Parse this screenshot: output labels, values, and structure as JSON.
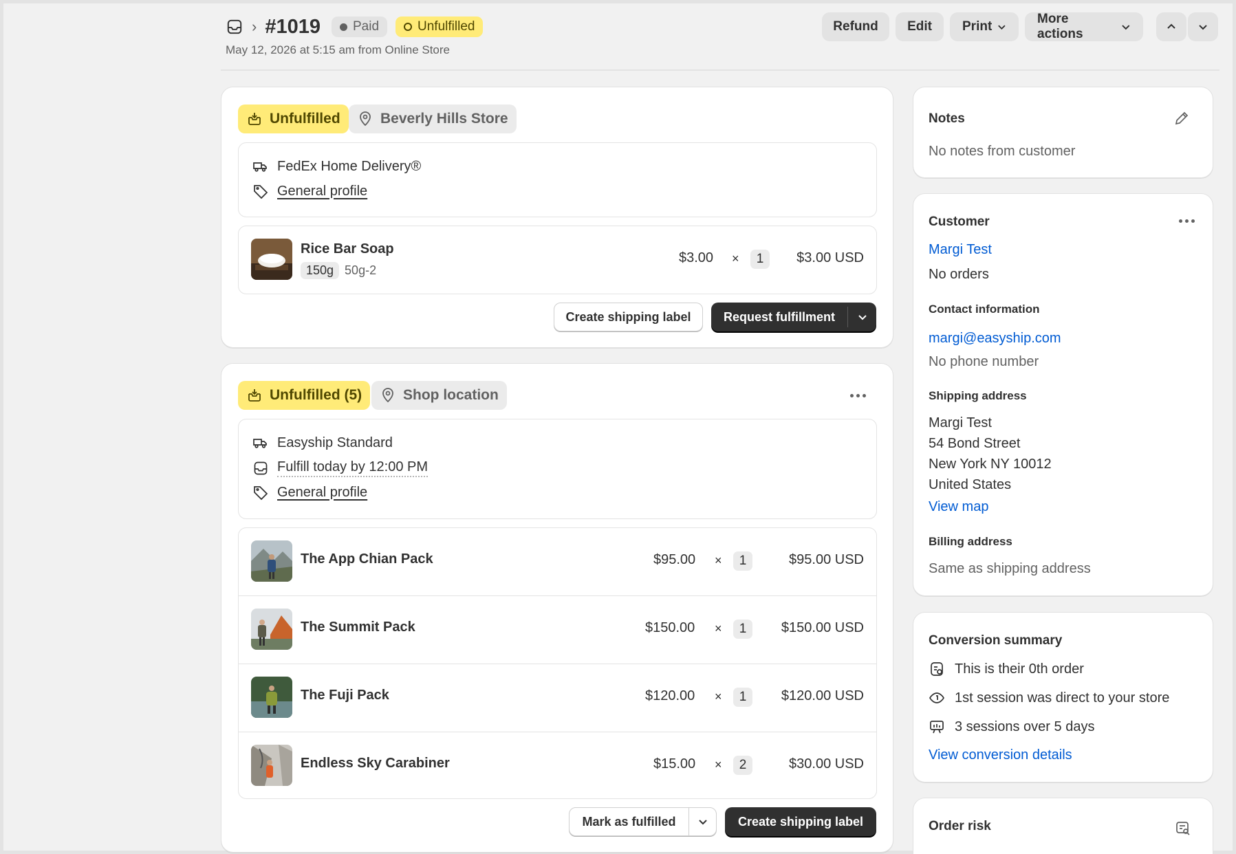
{
  "header": {
    "order_number": "#1019",
    "paid_badge": "Paid",
    "unfulfilled_badge": "Unfulfilled",
    "subline": "May 12, 2026 at 5:15 am from Online Store",
    "refund": "Refund",
    "edit": "Edit",
    "print": "Print",
    "more_actions": "More actions"
  },
  "fulfillment1": {
    "status": "Unfulfilled",
    "location": "Beverly Hills Store",
    "shipping_method": "FedEx Home Delivery®",
    "profile": "General profile",
    "items": [
      {
        "name": "Rice Bar Soap",
        "variant": "150g",
        "sku": "50g-2",
        "price": "$3.00",
        "times": "×",
        "qty": "1",
        "total": "$3.00 USD"
      }
    ],
    "create_label": "Create shipping label",
    "request": "Request fulfillment"
  },
  "fulfillment2": {
    "status": "Unfulfilled (5)",
    "location": "Shop location",
    "shipping_method": "Easyship Standard",
    "deadline": "Fulfill today by 12:00 PM",
    "profile": "General profile",
    "items": [
      {
        "name": "The App Chian Pack",
        "price": "$95.00",
        "times": "×",
        "qty": "1",
        "total": "$95.00 USD"
      },
      {
        "name": "The Summit Pack",
        "price": "$150.00",
        "times": "×",
        "qty": "1",
        "total": "$150.00 USD"
      },
      {
        "name": "The Fuji Pack",
        "price": "$120.00",
        "times": "×",
        "qty": "1",
        "total": "$120.00 USD"
      },
      {
        "name": "Endless Sky Carabiner",
        "price": "$15.00",
        "times": "×",
        "qty": "2",
        "total": "$30.00 USD"
      }
    ],
    "mark_fulfilled": "Mark as fulfilled",
    "create_label": "Create shipping label"
  },
  "notes": {
    "title": "Notes",
    "text": "No notes from customer"
  },
  "customer": {
    "title": "Customer",
    "name": "Margi Test",
    "orders": "No orders",
    "contact_title": "Contact information",
    "email": "margi@easyship.com",
    "phone": "No phone number",
    "shipping_title": "Shipping address",
    "address": [
      "Margi Test",
      "54 Bond Street",
      "New York NY 10012",
      "United States"
    ],
    "view_map": "View map",
    "billing_title": "Billing address",
    "billing": "Same as shipping address"
  },
  "conversion": {
    "title": "Conversion summary",
    "lines": [
      "This is their 0th order",
      "1st session was direct to your store",
      "3 sessions over 5 days"
    ],
    "link": "View conversion details"
  },
  "risk": {
    "title": "Order risk"
  },
  "colors": {
    "accent_link": "#005bd3",
    "badge_yellow": "#ffeb78",
    "dark_button": "#303030",
    "page_bg": "#f1f1f1"
  }
}
